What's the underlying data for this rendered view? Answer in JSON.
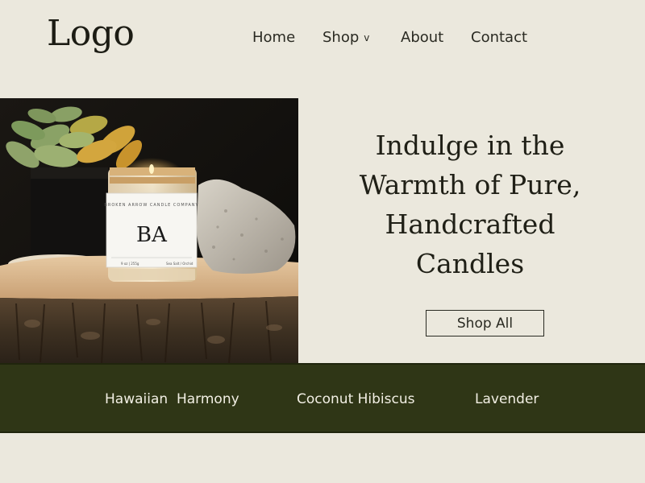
{
  "header": {
    "logo": "Logo",
    "nav": {
      "home": "Home",
      "shop": "Shop",
      "shop_chevron": "v",
      "about": "About",
      "contact": "Contact"
    }
  },
  "hero": {
    "heading_lines": [
      "Indulge in the",
      "Warmth of Pure,",
      "Handcrafted",
      "Candles"
    ],
    "cta": "Shop All",
    "image": {
      "label_brand": "BROKEN ARROW CANDLE COMPANY",
      "label_monogram": "BA",
      "label_weight": "9 oz | 255g",
      "label_scent": "Sea Salt / Orchid"
    }
  },
  "scents": {
    "items": [
      "Hawaiian  Harmony",
      "Coconut Hibiscus",
      "Lavender"
    ]
  },
  "colors": {
    "background": "#ebe8dd",
    "band": "#2f3616",
    "text": "#1e1e14",
    "band_text": "#f2efe4"
  }
}
